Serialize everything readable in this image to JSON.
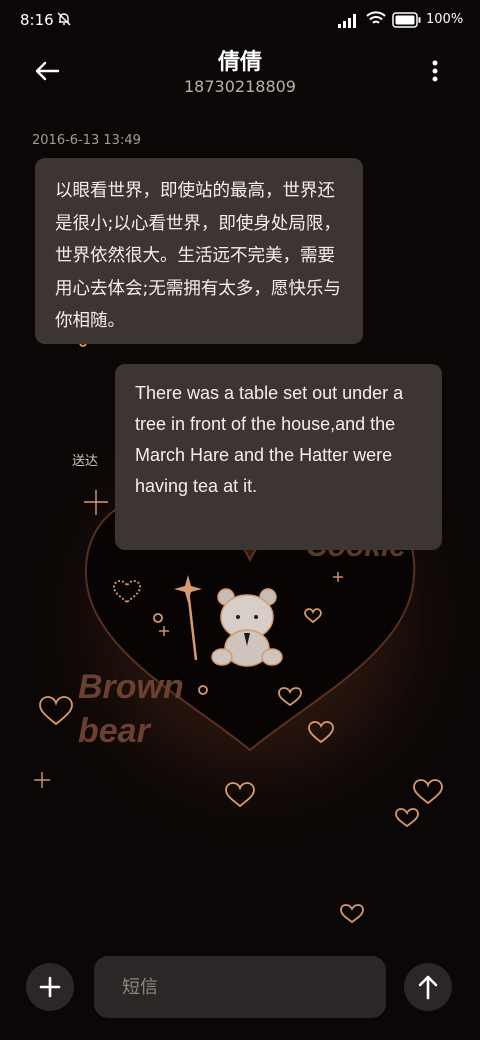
{
  "status_bar": {
    "time": "8:16",
    "battery": "100%",
    "icons": [
      "bell-muted-icon",
      "signal-icon",
      "wifi-icon",
      "battery-icon"
    ]
  },
  "header": {
    "contact_name": "倩倩",
    "contact_number": "18730218809",
    "icons": [
      "back-arrow-icon",
      "more-vertical-icon"
    ]
  },
  "conversation": {
    "timestamp": "2016-6-13 13:49",
    "messages": [
      {
        "direction": "incoming",
        "text": "以眼看世界，即使站的最高，世界还是很小;以心看世界，即使身处局限，世界依然很大。生活远不完美，需要用心去体会;无需拥有太多，愿快乐与你相随。"
      },
      {
        "direction": "outgoing",
        "text": "There was a table set out under a tree in front of the house,and the March Hare and the Hatter were having tea at it."
      }
    ],
    "delivery_status": "送达"
  },
  "wallpaper": {
    "text_lines": [
      "Brown",
      "bear",
      "Cookie"
    ],
    "accent_color": "#d79a6e",
    "glow_color": "#5a2d1d"
  },
  "composer": {
    "placeholder": "短信",
    "icons": [
      "plus-icon",
      "send-arrow-icon"
    ]
  },
  "colors": {
    "background": "#0b0706",
    "bubble": "#3c3532",
    "input": "#2a2726"
  }
}
